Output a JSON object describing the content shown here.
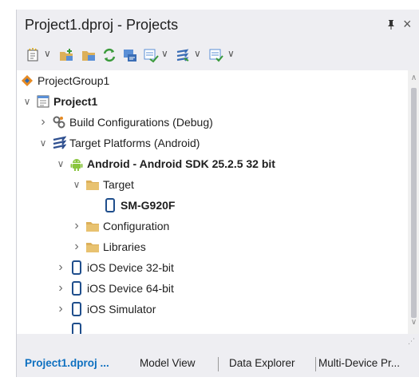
{
  "panel": {
    "title": "Project1.dproj - Projects",
    "pin_glyph": "q",
    "close_glyph": "×"
  },
  "toolbar": {
    "buttons": [
      {
        "icon": "new-item-icon"
      },
      {
        "icon": "add-new-project-icon"
      },
      {
        "icon": "add-existing-project-icon"
      },
      {
        "icon": "sync-icon"
      },
      {
        "icon": "build-all-icon"
      },
      {
        "icon": "compile-icon"
      },
      {
        "icon": "build-configurations-icon"
      },
      {
        "icon": "deploy-icon"
      }
    ],
    "dropdown_glyph": "∨"
  },
  "tree": {
    "items": [
      {
        "label": "ProjectGroup1",
        "icon": "project-group-icon",
        "bold": false,
        "chevron": ""
      },
      {
        "label": "Project1",
        "icon": "project-icon",
        "bold": true,
        "chevron": "∨"
      },
      {
        "label": "Build Configurations (Debug)",
        "icon": "build-configurations-icon",
        "bold": false,
        "chevron": "›"
      },
      {
        "label": "Target Platforms (Android)",
        "icon": "target-platforms-icon",
        "bold": false,
        "chevron": "∨"
      },
      {
        "label": "Android - Android SDK 25.2.5 32 bit",
        "icon": "android-icon",
        "bold": true,
        "chevron": "∨"
      },
      {
        "label": "Target",
        "icon": "folder-icon",
        "bold": false,
        "chevron": "∨"
      },
      {
        "label": "SM-G920F",
        "icon": "device-icon",
        "bold": true,
        "chevron": ""
      },
      {
        "label": "Configuration",
        "icon": "folder-icon",
        "bold": false,
        "chevron": "›"
      },
      {
        "label": "Libraries",
        "icon": "folder-icon",
        "bold": false,
        "chevron": "›"
      },
      {
        "label": "iOS Device 32-bit",
        "icon": "device-icon",
        "bold": false,
        "chevron": "›"
      },
      {
        "label": "iOS Device 64-bit",
        "icon": "device-icon",
        "bold": false,
        "chevron": "›"
      },
      {
        "label": "iOS Simulator",
        "icon": "device-icon",
        "bold": false,
        "chevron": "›"
      }
    ]
  },
  "scrollbar": {
    "up_glyph": "∧",
    "down_glyph": "∨"
  },
  "tabs": [
    {
      "label": "Project1.dproj ...",
      "active": true
    },
    {
      "label": "Model View",
      "active": false
    },
    {
      "label": "Data Explorer",
      "active": false
    },
    {
      "label": "Multi-Device Pr...",
      "active": false
    }
  ],
  "colors": {
    "accent": "#0e70c0",
    "panel_bg": "#eeeef2",
    "folder": "#dcb05a",
    "android": "#8ac53f",
    "device": "#1f4e8c"
  }
}
